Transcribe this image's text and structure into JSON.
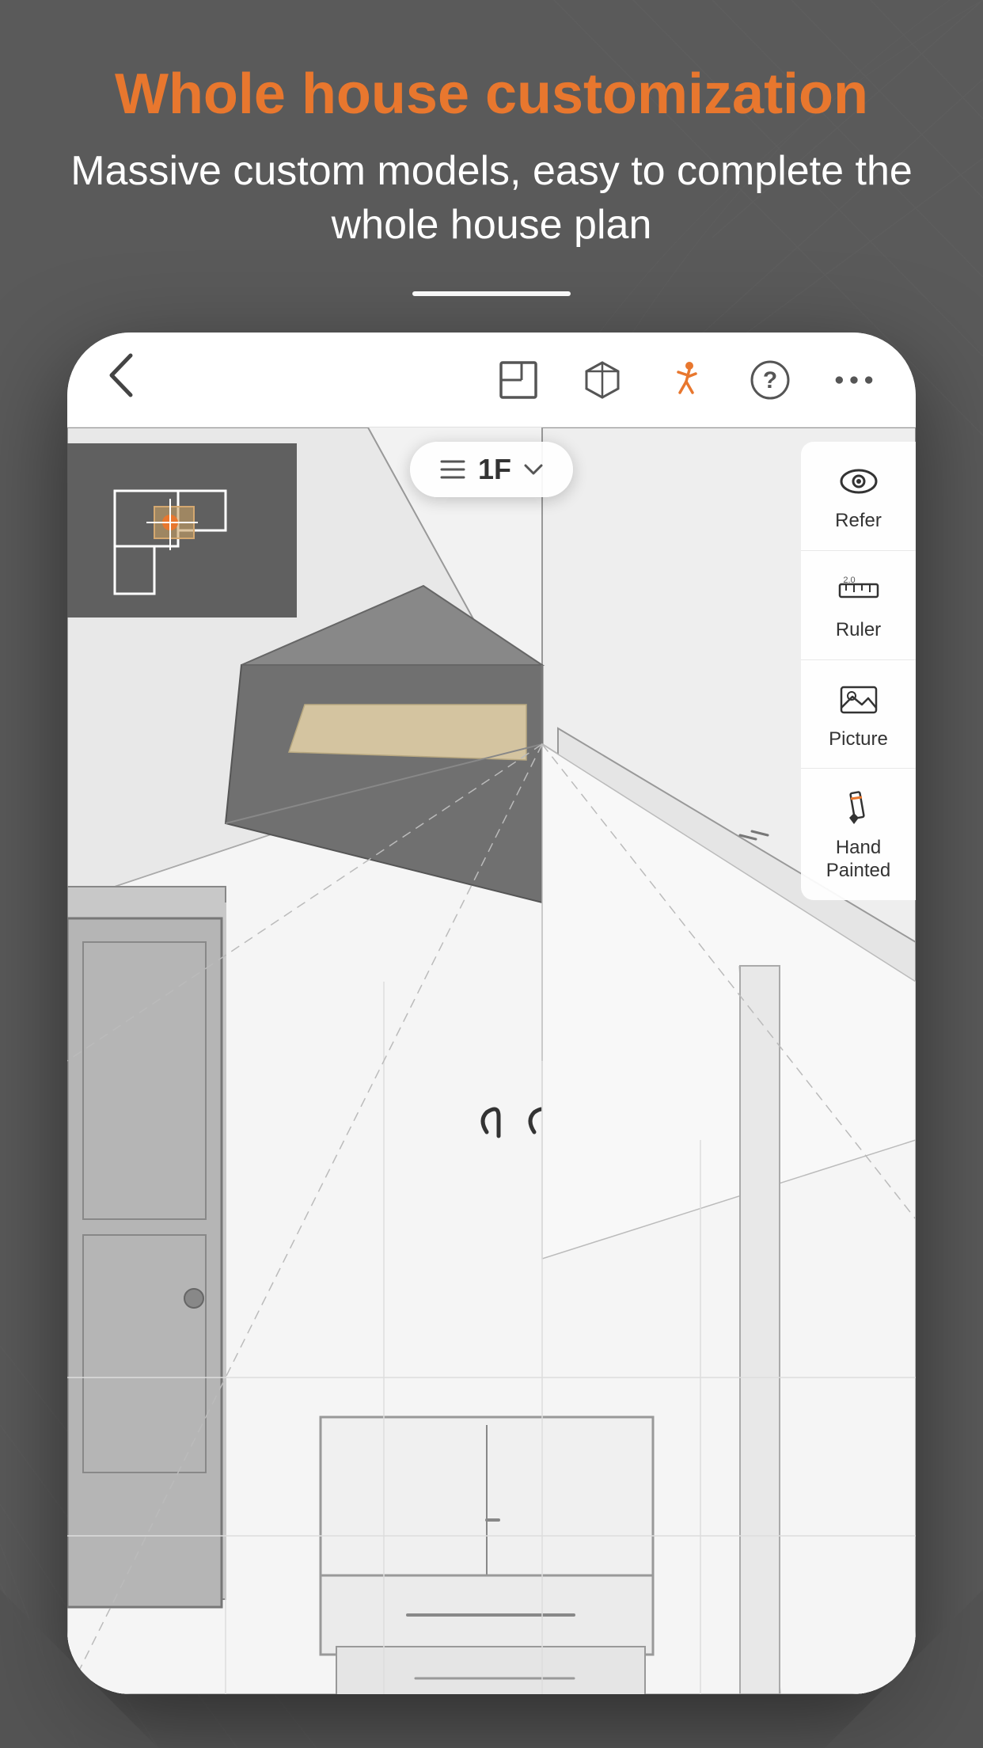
{
  "background": {
    "color": "#5a5a5a"
  },
  "header": {
    "title": "Whole house customization",
    "subtitle": "Massive custom models, easy to complete the whole house plan",
    "title_color": "#E8772E",
    "subtitle_color": "#ffffff"
  },
  "phone": {
    "topbar": {
      "back_icon": "‹",
      "floor_plan_icon": "□",
      "cube_icon": "⬡",
      "person_icon": "🚶",
      "help_icon": "?",
      "more_icon": "···"
    },
    "floor_selector": {
      "icon": "≡",
      "label": "1F",
      "chevron": "∨"
    },
    "sidebar": {
      "items": [
        {
          "id": "refer",
          "label": "Refer",
          "icon": "eye"
        },
        {
          "id": "ruler",
          "label": "Ruler",
          "icon": "ruler"
        },
        {
          "id": "picture",
          "label": "Picture",
          "icon": "image"
        },
        {
          "id": "hand-painted",
          "label": "Hand\nPainted",
          "icon": "pencil"
        }
      ]
    }
  }
}
